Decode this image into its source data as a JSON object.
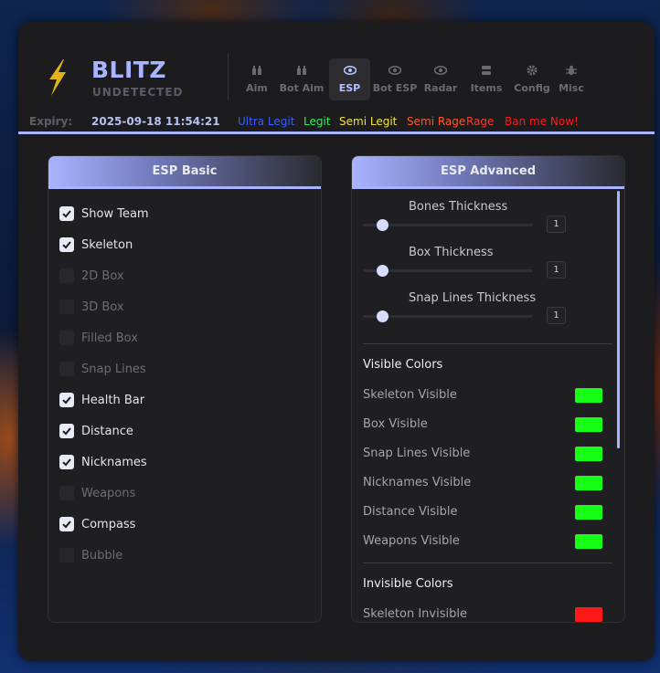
{
  "brand": {
    "title": "BLITZ",
    "subtitle": "UNDETECTED"
  },
  "tabs": [
    {
      "label": "Aim",
      "icon": "crosshair-icon",
      "active": false
    },
    {
      "label": "Bot Aim",
      "icon": "bot-icon",
      "active": false
    },
    {
      "label": "ESP",
      "icon": "eye-icon",
      "active": true
    },
    {
      "label": "Bot ESP",
      "icon": "eye-icon",
      "active": false
    },
    {
      "label": "Radar",
      "icon": "radar-icon",
      "active": false
    },
    {
      "label": "Items",
      "icon": "box-icon",
      "active": false
    },
    {
      "label": "Config",
      "icon": "gear-icon",
      "active": false
    },
    {
      "label": "Misc",
      "icon": "bug-icon",
      "active": false
    }
  ],
  "expiry": {
    "label": "Expiry:",
    "value": "2025-09-18 11:54:21"
  },
  "presets": [
    {
      "label": "Ultra Legit",
      "color": "#3b5bff"
    },
    {
      "label": "Legit",
      "color": "#2ef05a"
    },
    {
      "label": "Semi Legit",
      "color": "#f2e33a"
    },
    {
      "label": "Semi Rage",
      "color": "#ff5a2a"
    },
    {
      "label": "Rage",
      "color": "#ff3a2a"
    },
    {
      "label": "Ban me Now!",
      "color": "#ff1a1a"
    }
  ],
  "esp_basic": {
    "title": "ESP Basic",
    "items": [
      {
        "label": "Show Team",
        "checked": true
      },
      {
        "label": "Skeleton",
        "checked": true
      },
      {
        "label": "2D Box",
        "checked": false
      },
      {
        "label": "3D Box",
        "checked": false
      },
      {
        "label": "Filled Box",
        "checked": false
      },
      {
        "label": "Snap Lines",
        "checked": false
      },
      {
        "label": "Health Bar",
        "checked": true
      },
      {
        "label": "Distance",
        "checked": true
      },
      {
        "label": "Nicknames",
        "checked": true
      },
      {
        "label": "Weapons",
        "checked": false
      },
      {
        "label": "Compass",
        "checked": true
      },
      {
        "label": "Bubble",
        "checked": false
      }
    ]
  },
  "esp_advanced": {
    "title": "ESP Advanced",
    "sliders": [
      {
        "label": "Bones Thickness",
        "value": "1",
        "level": 0.0
      },
      {
        "label": "Box Thickness",
        "value": "1",
        "level": 0.0
      },
      {
        "label": "Snap Lines Thickness",
        "value": "1",
        "level": 0.0
      }
    ],
    "visible_title": "Visible Colors",
    "visible_colors": [
      {
        "label": "Skeleton Visible",
        "color": "#17ff17"
      },
      {
        "label": "Box Visible",
        "color": "#17ff17"
      },
      {
        "label": "Snap Lines Visible",
        "color": "#17ff17"
      },
      {
        "label": "Nicknames Visible",
        "color": "#17ff17"
      },
      {
        "label": "Distance Visible",
        "color": "#17ff17"
      },
      {
        "label": "Weapons Visible",
        "color": "#17ff17"
      }
    ],
    "invisible_title": "Invisible Colors",
    "invisible_colors": [
      {
        "label": "Skeleton Invisible",
        "color": "#ff1a1a"
      }
    ]
  },
  "colors": {
    "accent": "#a9b4ff",
    "expiry_label": "#5e5e66",
    "expiry_value": "#b8c0f0",
    "logo": "#e2b21a"
  }
}
